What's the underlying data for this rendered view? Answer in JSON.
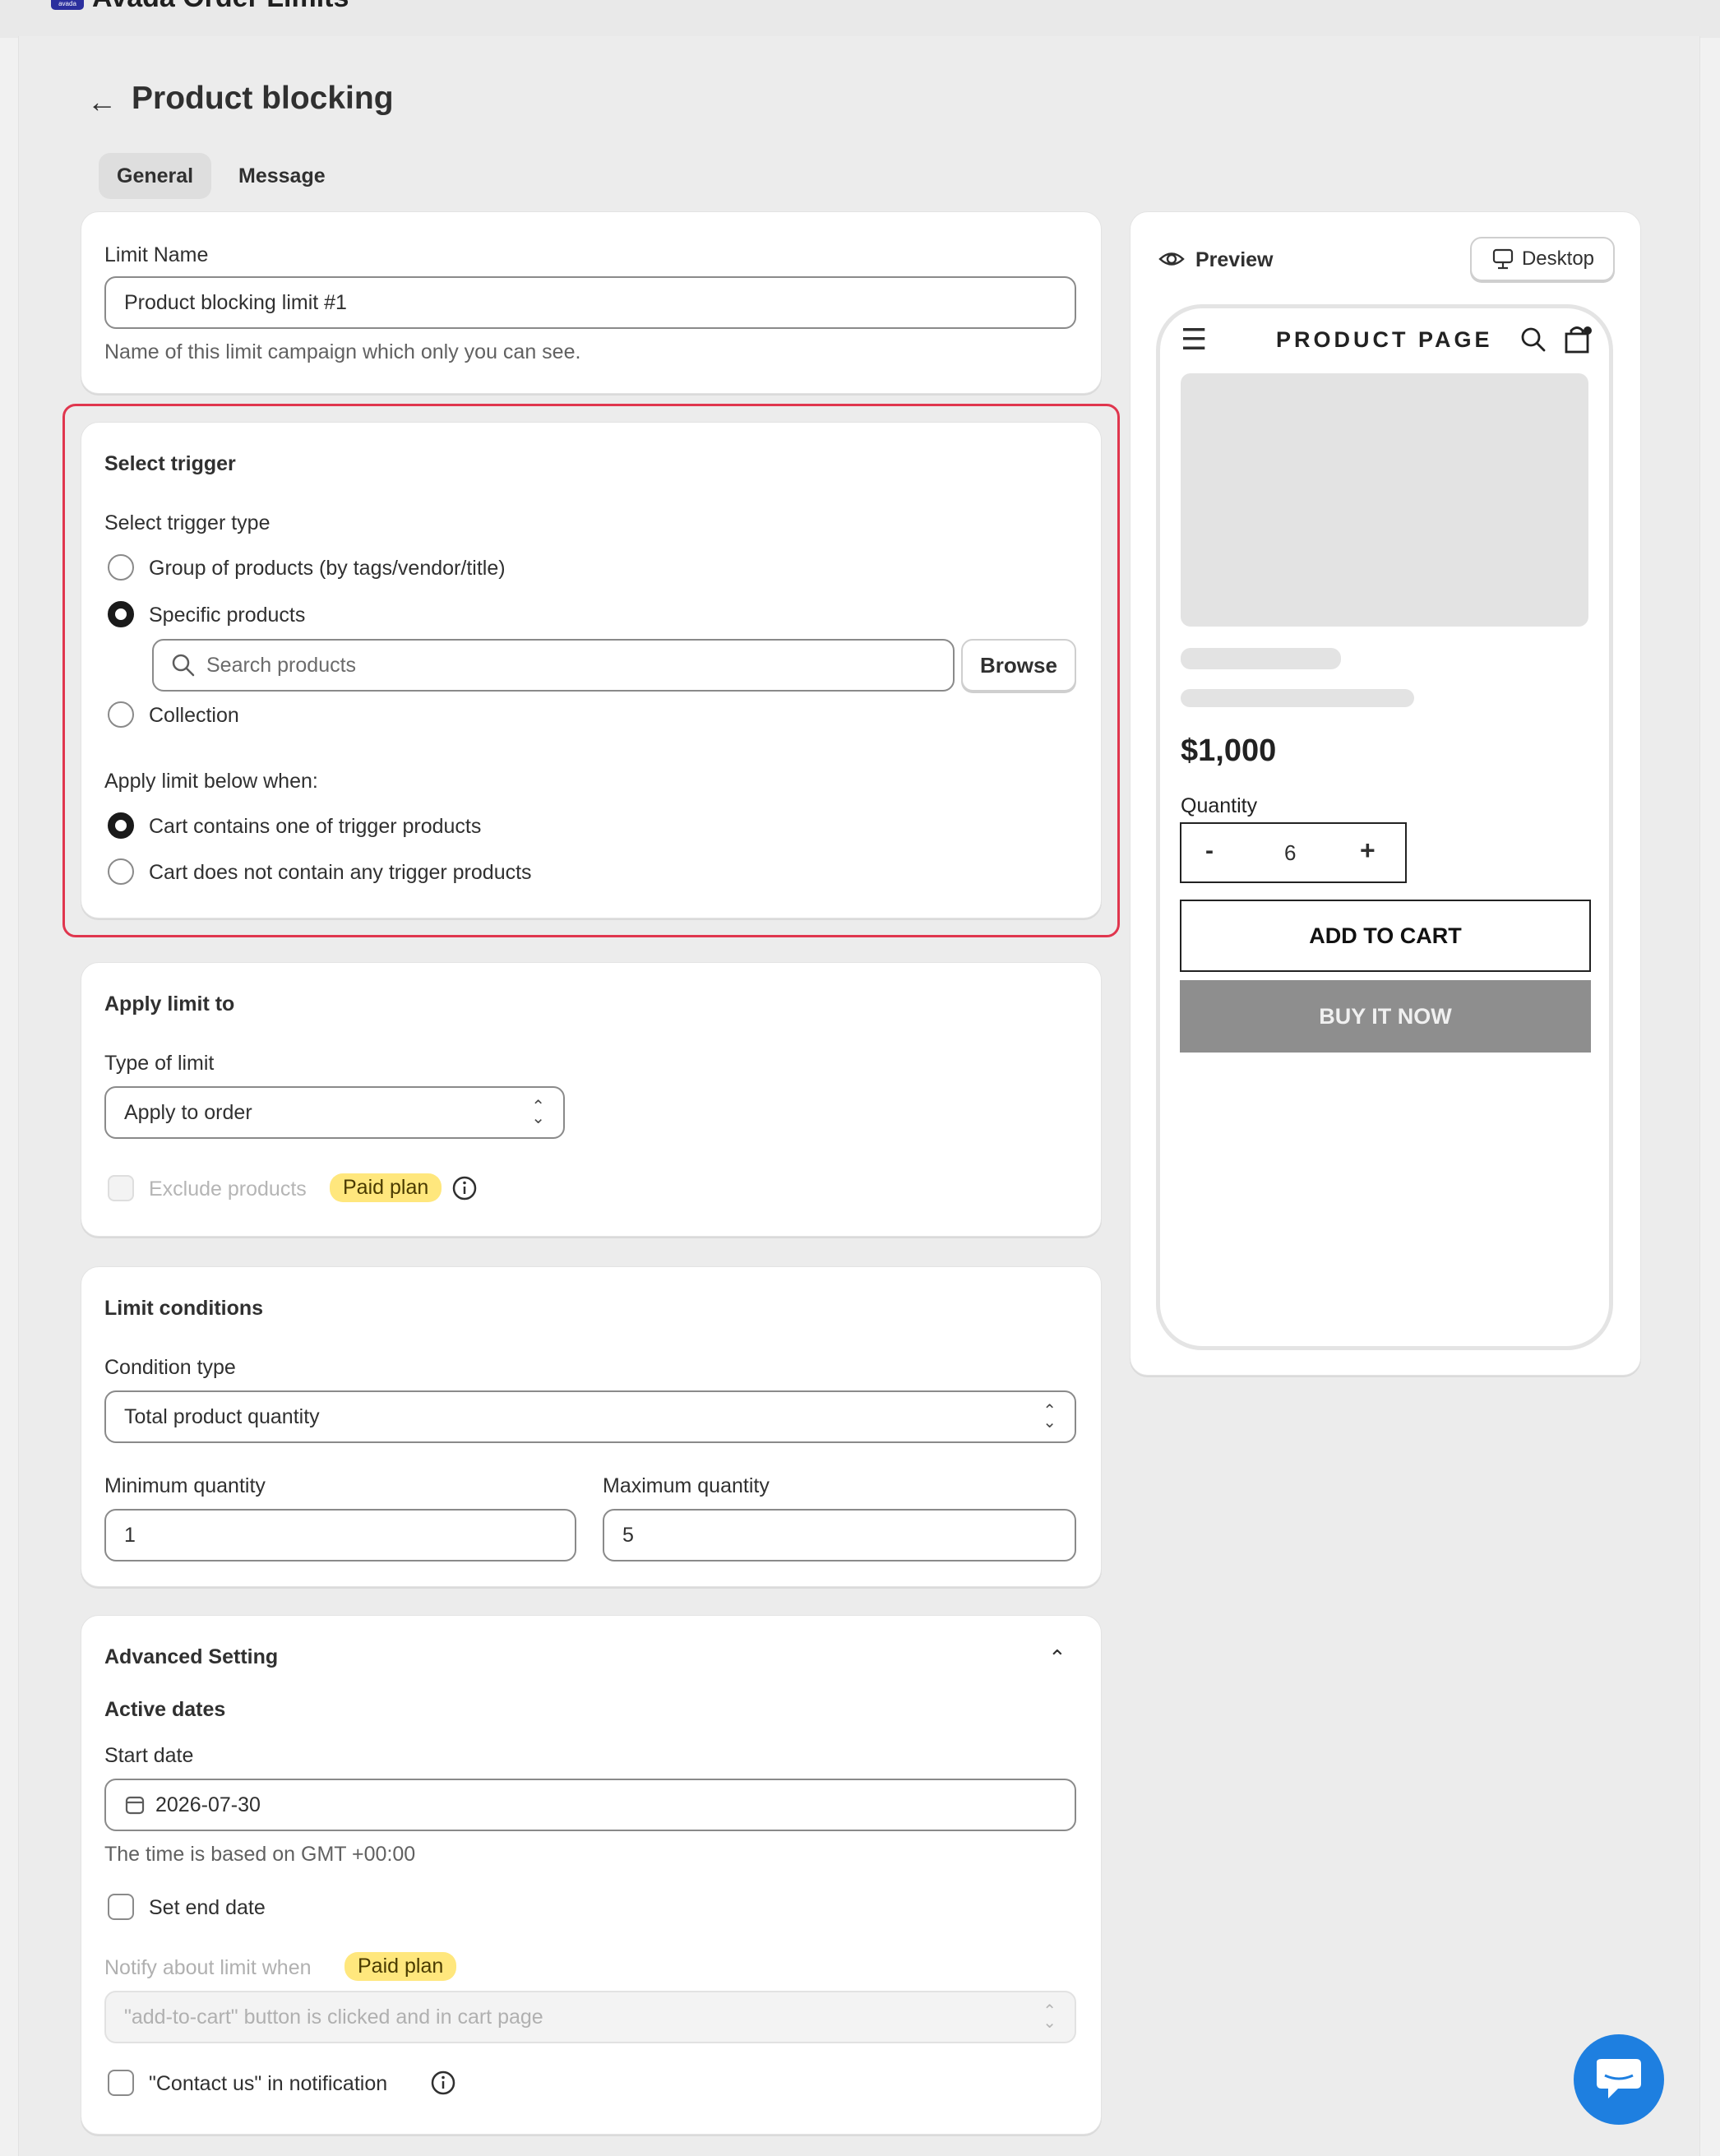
{
  "app": {
    "name": "Avada Order Limits",
    "logo_text": "avada"
  },
  "page": {
    "title": "Product blocking",
    "back_icon": "arrow-left-icon"
  },
  "tabs": [
    {
      "label": "General",
      "active": true
    },
    {
      "label": "Message",
      "active": false
    }
  ],
  "limit_name": {
    "label": "Limit Name",
    "value": "Product blocking limit #1",
    "help": "Name of this limit campaign which only you can see."
  },
  "trigger": {
    "heading": "Select trigger",
    "type_label": "Select trigger type",
    "options": [
      {
        "label": "Group of products (by tags/vendor/title)",
        "selected": false
      },
      {
        "label": "Specific products",
        "selected": true
      },
      {
        "label": "Collection",
        "selected": false
      }
    ],
    "search_placeholder": "Search products",
    "browse_label": "Browse",
    "apply_when_label": "Apply limit below when:",
    "apply_options": [
      {
        "label": "Cart contains one of trigger products",
        "selected": true
      },
      {
        "label": "Cart does not contain any trigger products",
        "selected": false
      }
    ],
    "highlight_color": "#e0364e"
  },
  "apply_limit": {
    "heading": "Apply limit to",
    "type_label": "Type of limit",
    "type_value": "Apply to order",
    "exclude_label": "Exclude products",
    "paid_badge": "Paid plan"
  },
  "conditions": {
    "heading": "Limit conditions",
    "type_label": "Condition type",
    "type_value": "Total product quantity",
    "min_label": "Minimum quantity",
    "min_value": "1",
    "max_label": "Maximum quantity",
    "max_value": "5"
  },
  "advanced": {
    "heading": "Advanced Setting",
    "active_dates": "Active dates",
    "start_label": "Start date",
    "start_value": "2026-07-30",
    "timezone_help": "The time is based on GMT +00:00",
    "end_date_label": "Set end date",
    "notify_label": "Notify about limit when",
    "notify_badge": "Paid plan",
    "notify_value": "\"add-to-cart\" button is clicked and in cart page",
    "contact_label": "\"Contact us\" in notification"
  },
  "preview": {
    "label": "Preview",
    "device_label": "Desktop",
    "store_title": "PRODUCT PAGE",
    "price": "$1,000",
    "quantity_label": "Quantity",
    "qty_minus": "-",
    "qty_value": "6",
    "qty_plus": "+",
    "add_to_cart": "ADD TO CART",
    "buy_now": "BUY IT NOW"
  },
  "colors": {
    "page_bg": "#ececec",
    "paid_badge": "#ffe77d",
    "buy_now_bg": "#8e8e8e",
    "chat_button": "#1e7fe0"
  }
}
